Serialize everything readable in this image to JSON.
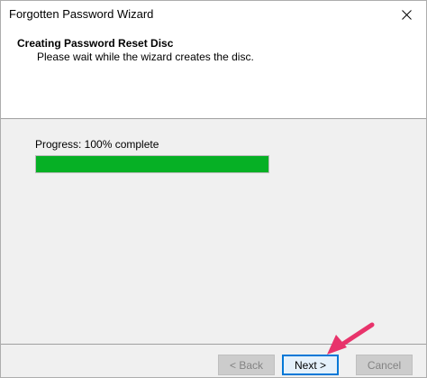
{
  "window": {
    "title": "Forgotten Password Wizard"
  },
  "header": {
    "title": "Creating Password Reset Disc",
    "subtitle": "Please wait while the wizard creates the disc."
  },
  "progress": {
    "label": "Progress: 100% complete",
    "percent": 100
  },
  "buttons": {
    "back": "< Back",
    "next": "Next >",
    "cancel": "Cancel"
  },
  "colors": {
    "progress_fill": "#06b025",
    "accent_border": "#0078d7",
    "annotation_arrow": "#e8336b"
  },
  "icons": {
    "close": "close-icon",
    "annotation": "arrow-pointer-icon"
  }
}
